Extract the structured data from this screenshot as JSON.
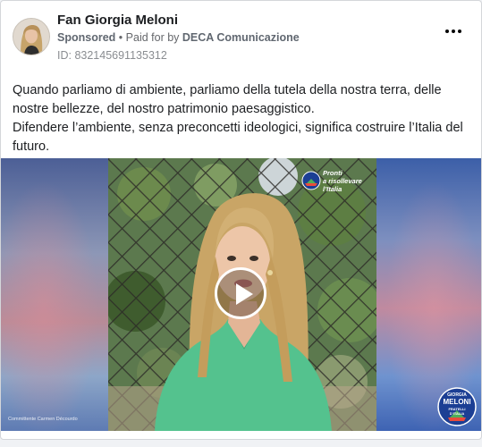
{
  "post": {
    "page_name": "Fan Giorgia Meloni",
    "sponsored": "Sponsored",
    "separator": "•",
    "paid_for_by": "Paid for by",
    "sponsor": "DECA Comunicazione",
    "ad_id": "ID: 832145691135312",
    "more_icon": "more-horizontal-icon",
    "text_line1": "Quando parliamo di ambiente, parliamo della tutela della nostra terra, delle nostre bellezze, del nostro patrimonio paesaggistico.",
    "text_line2": "Difendere l’ambiente, senza preconcetti ideologici, significa costruire l’Italia del futuro."
  },
  "video": {
    "play_icon": "play-icon",
    "watermark_line1": "Pronti",
    "watermark_line2": "a risollevare",
    "watermark_line3": "l’Italia",
    "credit": "Committente Carmen Décourdo",
    "logo_line1": "GIORGIA",
    "logo_line2": "MELONI",
    "logo_line3": "FRATELLI",
    "logo_line4": "D’ITALIA"
  },
  "colors": {
    "name_text": "#1c1e21",
    "meta_text": "#65676b",
    "shirt": "#54c28e",
    "logo_blue": "#1c3f94"
  }
}
